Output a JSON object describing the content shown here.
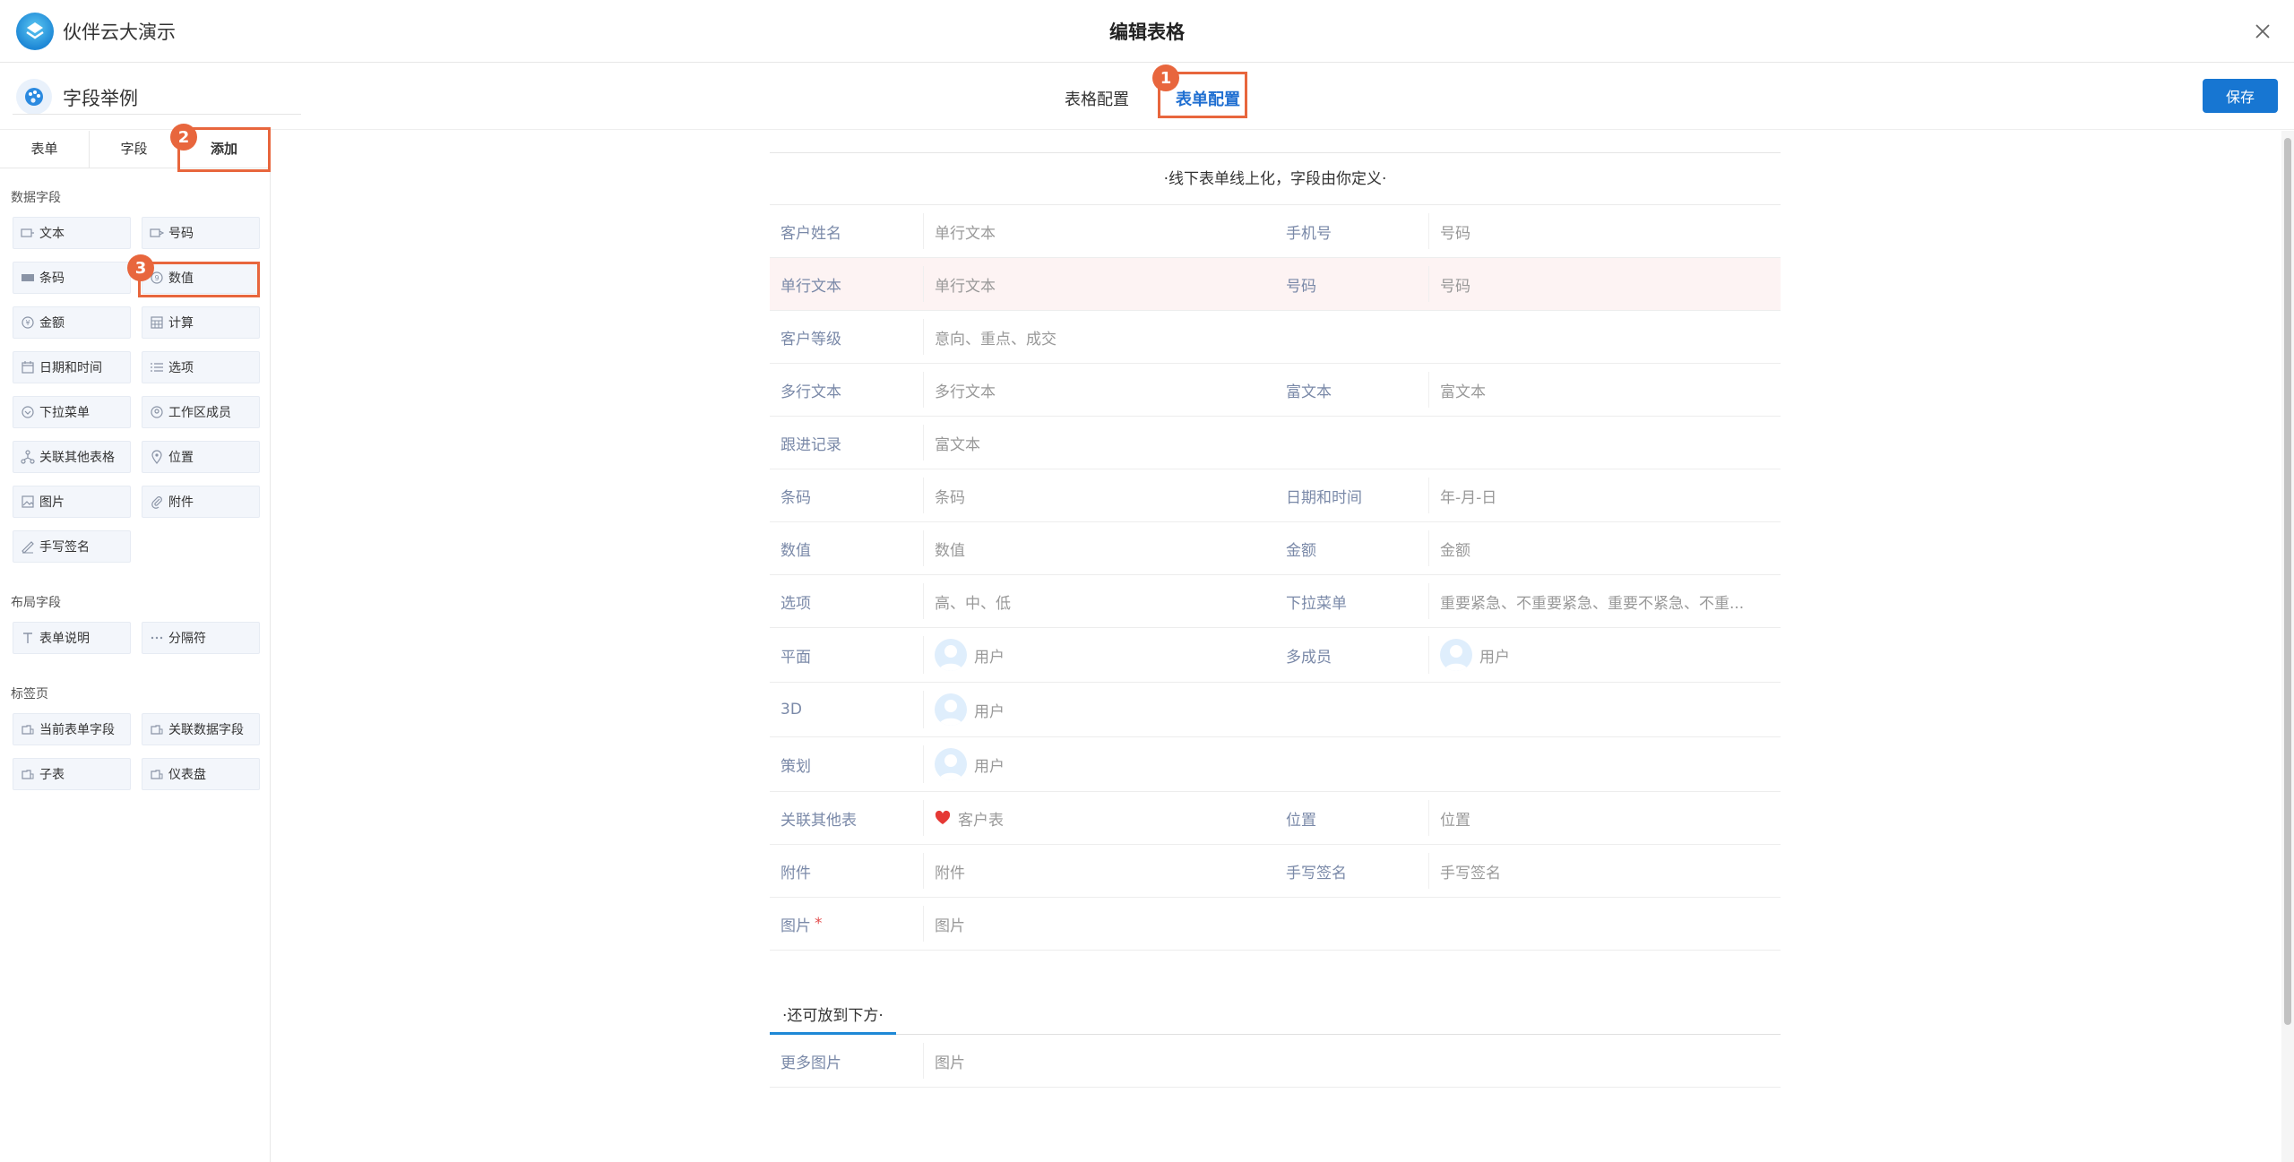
{
  "app": {
    "name": "伙伴云大演示",
    "dialog_title": "编辑表格"
  },
  "header": {
    "form_name": "字段举例",
    "tabs": [
      {
        "label": "表格配置"
      },
      {
        "label": "表单配置"
      }
    ],
    "save_label": "保存"
  },
  "sidebar": {
    "tabs": [
      {
        "label": "表单"
      },
      {
        "label": "字段"
      },
      {
        "label": "添加"
      }
    ],
    "groups": {
      "data_title": "数据字段",
      "data_fields": [
        {
          "label": "文本",
          "icon": "text-field-icon"
        },
        {
          "label": "号码",
          "icon": "number-field-icon"
        },
        {
          "label": "条码",
          "icon": "barcode-icon"
        },
        {
          "label": "数值",
          "icon": "numeric-icon"
        },
        {
          "label": "金额",
          "icon": "currency-icon"
        },
        {
          "label": "计算",
          "icon": "calculator-icon"
        },
        {
          "label": "日期和时间",
          "icon": "calendar-icon"
        },
        {
          "label": "选项",
          "icon": "list-icon"
        },
        {
          "label": "下拉菜单",
          "icon": "dropdown-icon"
        },
        {
          "label": "工作区成员",
          "icon": "member-icon"
        },
        {
          "label": "关联其他表格",
          "icon": "relation-icon"
        },
        {
          "label": "位置",
          "icon": "location-icon"
        },
        {
          "label": "图片",
          "icon": "image-icon"
        },
        {
          "label": "附件",
          "icon": "paperclip-icon"
        },
        {
          "label": "手写签名",
          "icon": "signature-icon"
        }
      ],
      "layout_title": "布局字段",
      "layout_fields": [
        {
          "label": "表单说明",
          "icon": "text-t-icon"
        },
        {
          "label": "分隔符",
          "icon": "ellipsis-icon"
        }
      ],
      "tab_title": "标签页",
      "tab_fields": [
        {
          "label": "当前表单字段",
          "icon": "tab-icon"
        },
        {
          "label": "关联数据字段",
          "icon": "tab-icon"
        },
        {
          "label": "子表",
          "icon": "tab-icon"
        },
        {
          "label": "仪表盘",
          "icon": "tab-icon"
        }
      ]
    }
  },
  "form": {
    "description": "·线下表单线上化，字段由你定义·",
    "rows": [
      {
        "cells": [
          {
            "label": "客户姓名",
            "value": "单行文本"
          },
          {
            "label": "手机号",
            "value": "号码"
          }
        ]
      },
      {
        "cells": [
          {
            "label": "单行文本",
            "value": "单行文本"
          },
          {
            "label": "号码",
            "value": "号码"
          }
        ]
      },
      {
        "cells": [
          {
            "label": "客户等级",
            "value": "意向、重点、成交"
          }
        ]
      },
      {
        "cells": [
          {
            "label": "多行文本",
            "value": "多行文本"
          },
          {
            "label": "富文本",
            "value": "富文本"
          }
        ]
      },
      {
        "cells": [
          {
            "label": "跟进记录",
            "value": "富文本"
          }
        ]
      },
      {
        "cells": [
          {
            "label": "条码",
            "value": "条码"
          },
          {
            "label": "日期和时间",
            "value": "年-月-日"
          }
        ]
      },
      {
        "cells": [
          {
            "label": "数值",
            "value": "数值"
          },
          {
            "label": "金额",
            "value": "金额"
          }
        ]
      },
      {
        "cells": [
          {
            "label": "选项",
            "value": "高、中、低"
          },
          {
            "label": "下拉菜单",
            "value": "重要紧急、不重要紧急、重要不紧急、不重..."
          }
        ]
      },
      {
        "cells": [
          {
            "label": "平面",
            "value": "用户"
          },
          {
            "label": "多成员",
            "value": "用户"
          }
        ]
      },
      {
        "cells": [
          {
            "label": "3D",
            "value": "用户"
          }
        ]
      },
      {
        "cells": [
          {
            "label": "策划",
            "value": "用户"
          }
        ]
      },
      {
        "cells": [
          {
            "label": "关联其他表",
            "value": "客户表"
          },
          {
            "label": "位置",
            "value": "位置"
          }
        ]
      },
      {
        "cells": [
          {
            "label": "附件",
            "value": "附件"
          },
          {
            "label": "手写签名",
            "value": "手写签名"
          }
        ]
      },
      {
        "cells": [
          {
            "label": "图片",
            "value": "图片",
            "required": "*"
          }
        ]
      }
    ],
    "section_tab": "·还可放到下方·",
    "bottom_row": {
      "label": "更多图片",
      "value": "图片"
    }
  },
  "annotations": {
    "badge1": "1",
    "badge2": "2",
    "badge3": "3"
  },
  "colors": {
    "accent": "#1776d2",
    "annotation": "#e8663d",
    "label": "#7a89a8",
    "highlight_row": "#fdf3f3"
  }
}
